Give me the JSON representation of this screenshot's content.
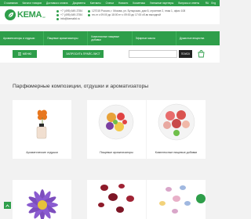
{
  "topnav": {
    "items": [
      "О компании",
      "Каталог товаров",
      "Доставка и оплата",
      "Документы",
      "Контакты",
      "Статьи",
      "Новости",
      "Косметика",
      "Успешные партнеры",
      "Вопросы и ответы"
    ],
    "lang": [
      "RU",
      "Eng"
    ]
  },
  "header": {
    "logo_text": "KEMA",
    "logo_sub": "ltd",
    "phone1": "+7 (495) 649-3784",
    "phone2": "+7 (495) 649-3784",
    "email": "info@kemaltd.ru",
    "address": "127015 Россия, г. Москва, ул. Бутырская, дом 6, строение 2, этаж 1, офис 108",
    "hours": "пн-чт с 09:00 до 18:00 пт с 09:00 до 17:00 сб-вс выходной"
  },
  "categories": [
    "Ароматизаторы и отдушки",
    "Пищевые ароматизаторы",
    "Комплексные пищевые добавки",
    "Эфирные масла",
    "Душистые вещества"
  ],
  "toolbar": {
    "menu_label": "МЕНЮ",
    "price_label": "ЗАПРОСИТЬ ПРАЙС-ЛИСТ",
    "search_placeholder": "",
    "search_label": "ПОИСК"
  },
  "section_title": "Парфюмерные композиции, отдушки и ароматизаторы",
  "products": [
    {
      "label": "Ароматические отдушки"
    },
    {
      "label": "Пищевые ароматизаторы"
    },
    {
      "label": "Комплексные пищевые добавки"
    }
  ],
  "colors": {
    "brand": "#2e9e4a",
    "dark": "#222222"
  }
}
